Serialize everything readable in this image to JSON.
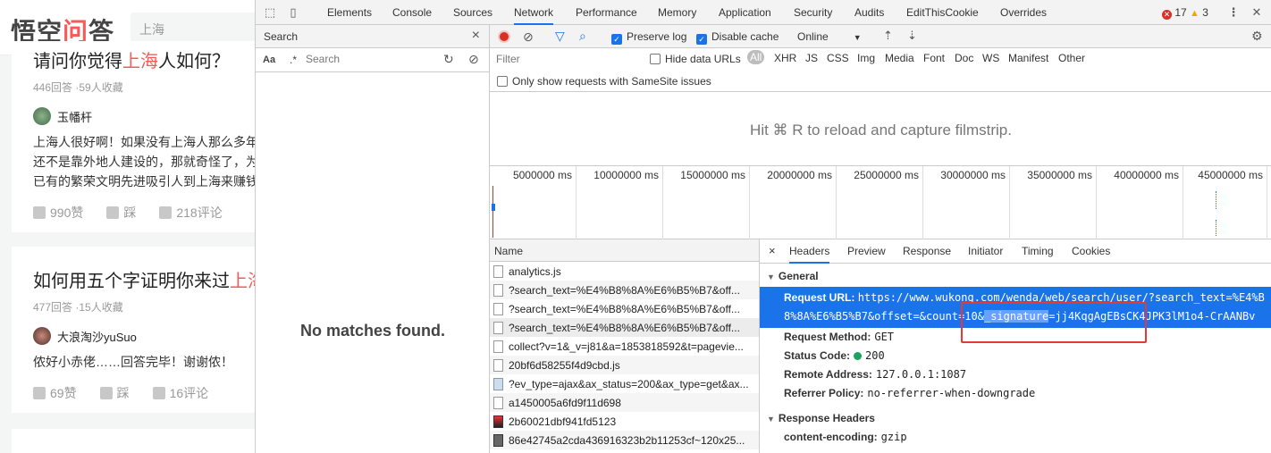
{
  "page": {
    "logo": {
      "part1": "悟空",
      "part2": "问",
      "part3": "答"
    },
    "search_placeholder": "上海",
    "cards": [
      {
        "title_pre": "请问你觉得",
        "title_hl": "上海",
        "title_post": "人如何？",
        "meta": "446回答  ·59人收藏",
        "author": "玉幡杆",
        "answer_lines": [
          "上海人很好啊！如果没有上海人那么多年",
          "还不是靠外地人建设的，那就奇怪了，为",
          "已有的繁荣文明先进吸引人到上海来赚钱"
        ],
        "likes": "990赞",
        "dislike": "踩",
        "comments": "218评论"
      },
      {
        "title_pre": "如何用五个字证明你来过",
        "title_hl": "上海",
        "title_post": "",
        "meta": "477回答  ·15人收藏",
        "author": "大浪淘沙yuSuo",
        "answer_lines": [
          "侬好小赤佬……回答完毕！谢谢侬！"
        ],
        "likes": "69赞",
        "dislike": "踩",
        "comments": "16评论"
      }
    ]
  },
  "devtools": {
    "tabs": [
      "Elements",
      "Console",
      "Sources",
      "Network",
      "Performance",
      "Memory",
      "Application",
      "Security",
      "Audits",
      "EditThisCookie",
      "Overrides"
    ],
    "active_tab": "Network",
    "errors": "17",
    "warnings": "3",
    "search_pane": {
      "title": "Search",
      "aa": "Aa",
      "regex": ".*",
      "placeholder": "Search",
      "empty_message": "No matches found."
    },
    "network": {
      "preserve_log": "Preserve log",
      "disable_cache": "Disable cache",
      "throttling": "Online",
      "filter_placeholder": "Filter",
      "hide_data_urls": "Hide data URLs",
      "types": [
        "All",
        "XHR",
        "JS",
        "CSS",
        "Img",
        "Media",
        "Font",
        "Doc",
        "WS",
        "Manifest",
        "Other"
      ],
      "samesite": "Only show requests with SameSite issues",
      "filmstrip_message": "Hit ⌘ R to reload and capture filmstrip.",
      "timeline_ticks": [
        "5000000 ms",
        "10000000 ms",
        "15000000 ms",
        "20000000 ms",
        "25000000 ms",
        "30000000 ms",
        "35000000 ms",
        "40000000 ms",
        "45000000 ms"
      ],
      "name_header": "Name",
      "requests": [
        "analytics.js",
        "?search_text=%E4%B8%8A%E6%B5%B7&off...",
        "?search_text=%E4%B8%8A%E6%B5%B7&off...",
        "?search_text=%E4%B8%8A%E6%B5%B7&off...",
        "collect?v=1&_v=j81&a=1853818592&t=pagevie...",
        "20bf6d58255f4d9cbd.js",
        "?ev_type=ajax&ax_status=200&ax_type=get&ax...",
        "a1450005a6fd9f11d698",
        "2b60021dbf941fd5123",
        "86e42745a2cda436916323b2b11253cf~120x25..."
      ],
      "detail_tabs": [
        "Headers",
        "Preview",
        "Response",
        "Initiator",
        "Timing",
        "Cookies"
      ],
      "active_detail_tab": "Headers",
      "general": {
        "title": "General",
        "request_url_label": "Request URL:",
        "request_url_line1": "https://www.wukong.com/wenda/web/search/user/?search_text=%E4%B",
        "request_url_line2_pre": "8%8A%E6%B5%B7&offset=&count=10&",
        "request_url_line2_hl": "_signature",
        "request_url_line2_post": "=jj4KqgAgEBsCK4JPK3lM1o4-CrAANBv",
        "request_method_label": "Request Method:",
        "request_method": "GET",
        "status_code_label": "Status Code:",
        "status_code": "200",
        "remote_address_label": "Remote Address:",
        "remote_address": "127.0.0.1:1087",
        "referrer_policy_label": "Referrer Policy:",
        "referrer_policy": "no-referrer-when-downgrade"
      },
      "response_headers": {
        "title": "Response Headers",
        "content_encoding_label": "content-encoding:",
        "content_encoding": "gzip"
      }
    }
  }
}
